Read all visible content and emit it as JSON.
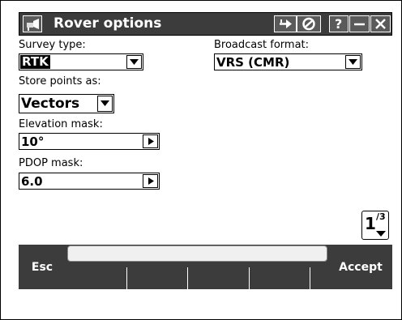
{
  "window": {
    "title": "Rover options",
    "icons": [
      "app-icon",
      "key-in-arrow-icon",
      "satellite-status-icon",
      "help-icon",
      "minimize-icon",
      "close-icon"
    ],
    "help_label": "?"
  },
  "form": {
    "survey_type": {
      "label": "Survey type:",
      "value": "RTK"
    },
    "broadcast_format": {
      "label": "Broadcast format:",
      "value": "VRS (CMR)"
    },
    "store_points_as": {
      "label": "Store points as:",
      "value": "Vectors"
    },
    "elevation_mask": {
      "label": "Elevation mask:",
      "value": "10°"
    },
    "pdop_mask": {
      "label": "PDOP mask:",
      "value": "6.0"
    }
  },
  "pager": {
    "current": "1",
    "total": "3"
  },
  "softkeys": {
    "esc": "Esc",
    "accept": "Accept"
  },
  "colors": {
    "titlebar": "#3c3c3c",
    "softbar": "#3c3c3c",
    "selection": "#000000"
  }
}
